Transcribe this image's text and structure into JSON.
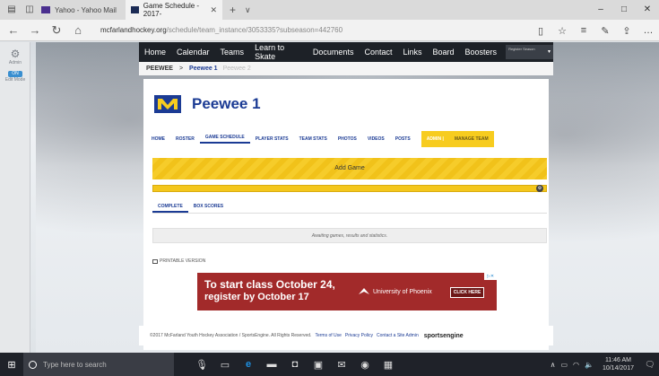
{
  "browser": {
    "tabs": [
      {
        "title": "Yahoo - Yahoo Mail",
        "active": false
      },
      {
        "title": "Game Schedule - 2017-",
        "active": true
      }
    ],
    "url_host": "mcfarlandhockey.org",
    "url_path": "/schedule/team_instance/3053335?subseason=442760"
  },
  "admin_bar": {
    "admin_label": "Admin",
    "edit_mode_label": "Edit Mode",
    "toggle_label": "ON"
  },
  "site_nav": {
    "links": [
      "Home",
      "Calendar",
      "Teams",
      "Learn to Skate",
      "Documents",
      "Contact",
      "Links",
      "Board",
      "Boosters"
    ],
    "season_select": "Register Season"
  },
  "breadcrumb": {
    "root": "PEEWEE",
    "sep": ">",
    "current": "Peewee 1",
    "other": "Peewee 2"
  },
  "team": {
    "name": "Peewee 1",
    "logo": "M"
  },
  "team_tabs": [
    "HOME",
    "ROSTER",
    "GAME SCHEDULE",
    "PLAYER STATS",
    "TEAM STATS",
    "PHOTOS",
    "VIDEOS",
    "POSTS"
  ],
  "team_tabs_active": "GAME SCHEDULE",
  "admin_tabs": [
    "ADMIN |",
    "MANAGE TEAM"
  ],
  "add_game_label": "Add Game",
  "schedule_tabs": [
    "COMPLETE",
    "BOX SCORES"
  ],
  "empty_message": "Awaiting games, results and statistics.",
  "printable_label": "PRINTABLE VERSION",
  "ad": {
    "line1": "To start class October 24,",
    "line2": "register by October 17",
    "brand": "University of Phoenix",
    "cta": "CLICK HERE"
  },
  "footer": {
    "copyright": "©2017 McFarland Youth Hockey Association / SportsEngine. All Rights Reserved.",
    "links": [
      "Terms of Use",
      "Privacy Policy",
      "Contact a Site Admin"
    ],
    "brand": "sportsengine"
  },
  "taskbar": {
    "search_placeholder": "Type here to search",
    "time": "11:46 AM",
    "date": "10/14/2017"
  },
  "colors": {
    "brand_blue": "#1b3b94",
    "admin_yellow": "#f7cc1f",
    "ad_red": "#a22a2a"
  }
}
